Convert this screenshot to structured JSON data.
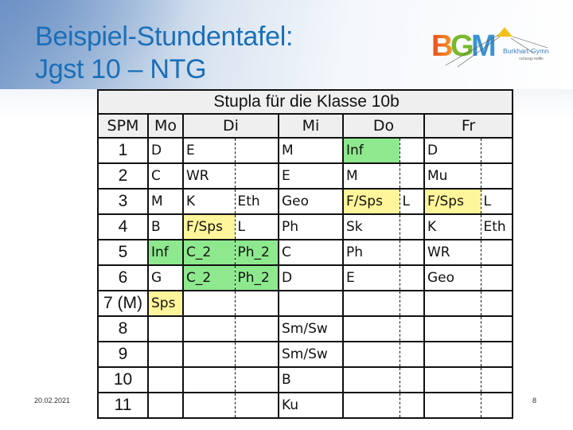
{
  "slide": {
    "title_line1": "Beispiel-Stundentafel:",
    "title_line2": "Jgst 10 – NTG",
    "footer_date": "20.02.2021",
    "page_number": "8",
    "logo": {
      "letters": "BGM",
      "name": "Burkhart-Gymnasium",
      "subtitle": "Achtung! Hälfte"
    }
  },
  "colors": {
    "title": "#1a6fb8",
    "highlight_green": "#8ee98e",
    "highlight_yellow": "#fff59a",
    "header_bg": "#efefef"
  },
  "timetable": {
    "title": "Stupla für die Klasse 10b",
    "headers": [
      "SPM",
      "Mo",
      "Di",
      "Mi",
      "Do",
      "Fr"
    ],
    "rows": [
      {
        "spm": "1",
        "mo": "D",
        "di_a": "E",
        "di_b": "",
        "mi": "M",
        "do_a": "Inf",
        "do_b": "",
        "fr_a": "D",
        "fr_b": ""
      },
      {
        "spm": "2",
        "mo": "C",
        "di_a": "WR",
        "di_b": "",
        "mi": "E",
        "do_a": "M",
        "do_b": "",
        "fr_a": "Mu",
        "fr_b": ""
      },
      {
        "spm": "3",
        "mo": "M",
        "di_a": "K",
        "di_b": "Eth",
        "mi": "Geo",
        "do_a": "F/Sps",
        "do_b": "L",
        "fr_a": "F/Sps",
        "fr_b": "L"
      },
      {
        "spm": "4",
        "mo": "B",
        "di_a": "F/Sps",
        "di_b": "L",
        "mi": "Ph",
        "do_a": "Sk",
        "do_b": "",
        "fr_a": "K",
        "fr_b": "Eth"
      },
      {
        "spm": "5",
        "mo": "Inf",
        "di_a": "C_2",
        "di_b": "Ph_2",
        "mi": "C",
        "do_a": "Ph",
        "do_b": "",
        "fr_a": "WR",
        "fr_b": ""
      },
      {
        "spm": "6",
        "mo": "G",
        "di_a": "C_2",
        "di_b": "Ph_2",
        "mi": "D",
        "do_a": "E",
        "do_b": "",
        "fr_a": "Geo",
        "fr_b": ""
      },
      {
        "spm": "7 (M)",
        "mo": "Sps",
        "di_a": "",
        "di_b": "",
        "mi": "",
        "do_a": "",
        "do_b": "",
        "fr_a": "",
        "fr_b": ""
      },
      {
        "spm": "8",
        "mo": "",
        "di_a": "",
        "di_b": "",
        "mi": "Sm/Sw",
        "do_a": "",
        "do_b": "",
        "fr_a": "",
        "fr_b": ""
      },
      {
        "spm": "9",
        "mo": "",
        "di_a": "",
        "di_b": "",
        "mi": "Sm/Sw",
        "do_a": "",
        "do_b": "",
        "fr_a": "",
        "fr_b": ""
      },
      {
        "spm": "10",
        "mo": "",
        "di_a": "",
        "di_b": "",
        "mi": "B",
        "do_a": "",
        "do_b": "",
        "fr_a": "",
        "fr_b": ""
      },
      {
        "spm": "11",
        "mo": "",
        "di_a": "",
        "di_b": "",
        "mi": "Ku",
        "do_a": "",
        "do_b": "",
        "fr_a": "",
        "fr_b": ""
      }
    ]
  }
}
